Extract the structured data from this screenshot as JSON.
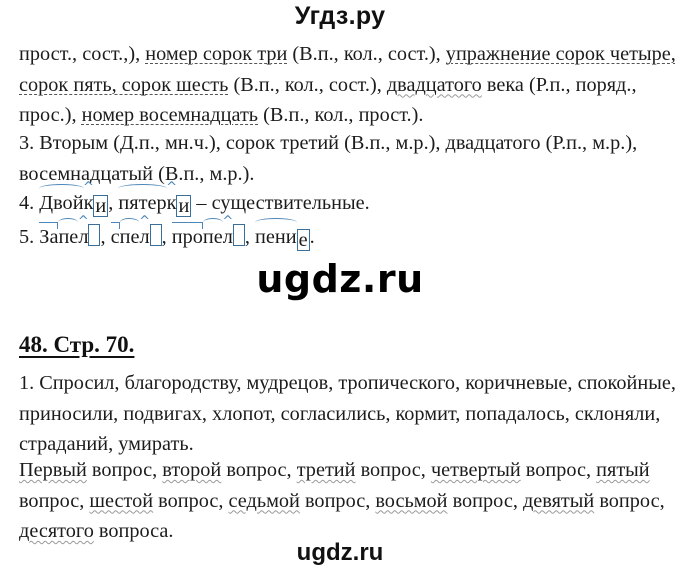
{
  "watermarks": {
    "top": "Угдз.ру",
    "middle": "ugdz.ru",
    "bottom": "ugdz.ru"
  },
  "section_a": {
    "lines": [
      [
        {
          "t": "прост., сост.,), "
        },
        {
          "t": "номер сорок три",
          "u": "dash"
        },
        {
          "t": " (В.п., кол., сост.), "
        },
        {
          "t": "упражнение сорок четыре,",
          "u": "dash"
        }
      ],
      [
        {
          "t": "сорок пять, сорок шесть",
          "u": "dash"
        },
        {
          "t": " (В.п., кол., сост.), "
        },
        {
          "t": "двадцатого",
          "u": "wavy"
        },
        {
          "t": " века (Р.п., поряд.,"
        }
      ],
      [
        {
          "t": "прос.), "
        },
        {
          "t": "номер восемнадцать",
          "u": "dash"
        },
        {
          "t": " (В.п., кол., прост.)."
        }
      ]
    ]
  },
  "item3": {
    "lines": [
      "3. Вторым (Д.п., мн.ч.), сорок третий (В.п., м.р.), двадцатого (Р.п., м.р.),",
      "восемнадцатый (В.п., м.р.)."
    ]
  },
  "item4": {
    "number": "4. ",
    "words": [
      {
        "root": "Двой",
        "suffix": "к",
        "ending": "и",
        "after": ", "
      },
      {
        "root": "пятер",
        "suffix": "к",
        "ending": "и",
        "after": " – существительные."
      }
    ]
  },
  "item5": {
    "number": "5. ",
    "words": [
      {
        "prefix": "За",
        "root": "пе",
        "suffix": "л",
        "ending": "",
        "after": ", "
      },
      {
        "prefix": "с",
        "root": "пе",
        "suffix": "л",
        "ending": "",
        "after": ", "
      },
      {
        "prefix": "про",
        "root": "пе",
        "suffix": "л",
        "ending": "",
        "after": ", "
      },
      {
        "prefix": "",
        "root": "пени",
        "suffix": "",
        "ending": "е",
        "after": "."
      }
    ]
  },
  "exercise48": {
    "heading": "48. Стр. 70.",
    "item1_lines": [
      "1. Спросил, благородству, мудрецов, тропического, коричневые, спокойные,",
      "приносили, подвигах, хлопот, согласились, кормит, попадалось, склоняли,",
      "страданий, умирать."
    ],
    "ordinals_lines": [
      [
        {
          "t": "Первый",
          "u": "wavy"
        },
        {
          "t": " вопрос, "
        },
        {
          "t": "второй",
          "u": "wavy"
        },
        {
          "t": " вопрос, "
        },
        {
          "t": "третий",
          "u": "wavy"
        },
        {
          "t": " вопрос, "
        },
        {
          "t": "четвертый",
          "u": "wavy"
        },
        {
          "t": " вопрос, "
        },
        {
          "t": "пятый",
          "u": "wavy"
        }
      ],
      [
        {
          "t": "вопрос, "
        },
        {
          "t": "шестой",
          "u": "wavy"
        },
        {
          "t": " вопрос, "
        },
        {
          "t": "седьмой",
          "u": "wavy"
        },
        {
          "t": " вопрос, "
        },
        {
          "t": "восьмой",
          "u": "wavy"
        },
        {
          "t": " вопрос, "
        },
        {
          "t": "девятый",
          "u": "wavy"
        },
        {
          "t": " вопрос,"
        }
      ],
      [
        {
          "t": "десятого",
          "u": "wavy"
        },
        {
          "t": " вопроса."
        }
      ]
    ]
  }
}
